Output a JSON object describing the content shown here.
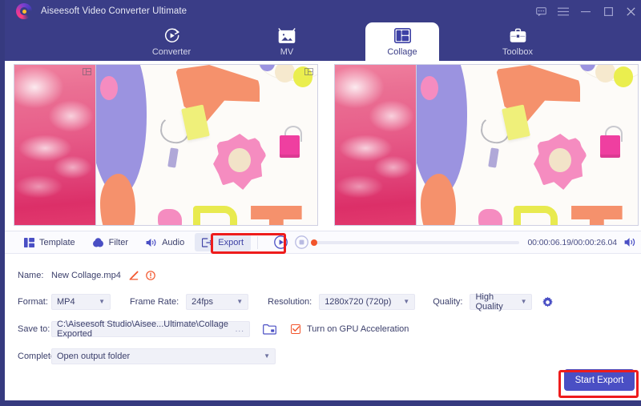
{
  "app": {
    "title": "Aiseesoft Video Converter Ultimate",
    "logo_icon": "aiseesoft-logo-icon"
  },
  "window_controls": [
    {
      "name": "feedback-icon",
      "label": "Feedback"
    },
    {
      "name": "menu-icon",
      "label": "Menu"
    },
    {
      "name": "minimize-icon",
      "label": "Minimize"
    },
    {
      "name": "maximize-icon",
      "label": "Maximize"
    },
    {
      "name": "close-icon",
      "label": "Close"
    }
  ],
  "tabs": [
    {
      "label": "Converter",
      "icon": "converter-icon",
      "active": false
    },
    {
      "label": "MV",
      "icon": "mv-icon",
      "active": false
    },
    {
      "label": "Collage",
      "icon": "collage-icon",
      "active": true
    },
    {
      "label": "Toolbox",
      "icon": "toolbox-icon",
      "active": false
    }
  ],
  "preview": {
    "left_pane_name": "collage-editor-pane",
    "right_pane_name": "collage-preview-pane",
    "cell_corner_icon": "grid-resize-icon"
  },
  "tools": [
    {
      "label": "Template",
      "icon": "template-icon",
      "active": false
    },
    {
      "label": "Filter",
      "icon": "filter-icon",
      "active": false
    },
    {
      "label": "Audio",
      "icon": "audio-icon",
      "active": false
    },
    {
      "label": "Export",
      "icon": "export-icon",
      "active": true
    }
  ],
  "player": {
    "play_icon": "play-icon",
    "stop_icon": "stop-icon",
    "playhead_color": "#f2552c",
    "progress_percent": 0,
    "timecode": "00:00:06.19/00:00:26.04",
    "current_time": "00:00:06.19",
    "total_time": "00:00:26.04",
    "volume_icon": "volume-icon"
  },
  "export": {
    "name_label": "Name:",
    "name_value": "New Collage.mp4",
    "edit_icon": "pencil-edit-icon",
    "info_icon": "warning-info-icon",
    "format_label": "Format:",
    "format_value": "MP4",
    "framerate_label": "Frame Rate:",
    "framerate_value": "24fps",
    "resolution_label": "Resolution:",
    "resolution_value": "1280x720 (720p)",
    "quality_label": "Quality:",
    "quality_value": "High Quality",
    "settings_icon": "gear-icon",
    "saveto_label": "Save to:",
    "saveto_value": "C:\\Aiseesoft Studio\\Aisee...Ultimate\\Collage Exported",
    "browse_dots": "...",
    "open_folder_icon": "open-folder-icon",
    "gpu_label": "Turn on GPU Acceleration",
    "gpu_checked": true,
    "complete_label": "Complete:",
    "complete_value": "Open output folder",
    "start_button": "Start Export"
  },
  "annotations": [
    {
      "name": "export-tab-highlight",
      "color": "#ee1c1c"
    },
    {
      "name": "start-export-highlight",
      "color": "#ee1c1c"
    }
  ]
}
